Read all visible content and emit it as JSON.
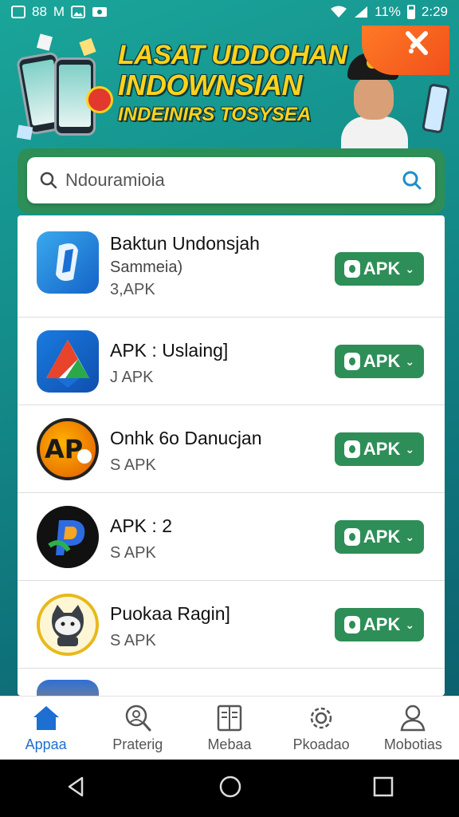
{
  "status_bar": {
    "left_text": "88",
    "left_letter": "M",
    "signal_text": "11%",
    "time": "2:29"
  },
  "banner": {
    "title_line1": "LASAT UDDOHAN",
    "title_line2": "INDOWNSIAN",
    "title_line3": "INDEINIRS TOSYSEA"
  },
  "search": {
    "value": "Ndouramioia"
  },
  "apps": [
    {
      "name": "Baktun Undonsjah",
      "subtitle": "Sammeia)",
      "size": "3,APK",
      "button": "APK",
      "icon": "blue-scroll-icon"
    },
    {
      "name": "APK : Uslaing]",
      "subtitle": "",
      "size": "J APK",
      "button": "APK",
      "icon": "triangle-logo-icon"
    },
    {
      "name": "Onhk 6o Danucjan",
      "subtitle": "",
      "size": "S APK",
      "button": "APK",
      "icon": "ap-cartoon-icon"
    },
    {
      "name": "APK : 2",
      "subtitle": "",
      "size": "S APK",
      "button": "APK",
      "icon": "colorful-p-icon"
    },
    {
      "name": "Puokaa Ragin]",
      "subtitle": "",
      "size": "S APK",
      "button": "APK",
      "icon": "cat-mascot-icon"
    }
  ],
  "bottom_nav": [
    {
      "label": "Appaa",
      "icon": "home-icon",
      "active": true
    },
    {
      "label": "Praterig",
      "icon": "search-person-icon",
      "active": false
    },
    {
      "label": "Mebaa",
      "icon": "book-icon",
      "active": false
    },
    {
      "label": "Pkoadao",
      "icon": "gear-icon",
      "active": false
    },
    {
      "label": "Mobotias",
      "icon": "person-icon",
      "active": false
    }
  ],
  "colors": {
    "accent_green": "#2e8e57",
    "active_blue": "#1d6fd1",
    "banner_yellow": "#ffd21a"
  }
}
